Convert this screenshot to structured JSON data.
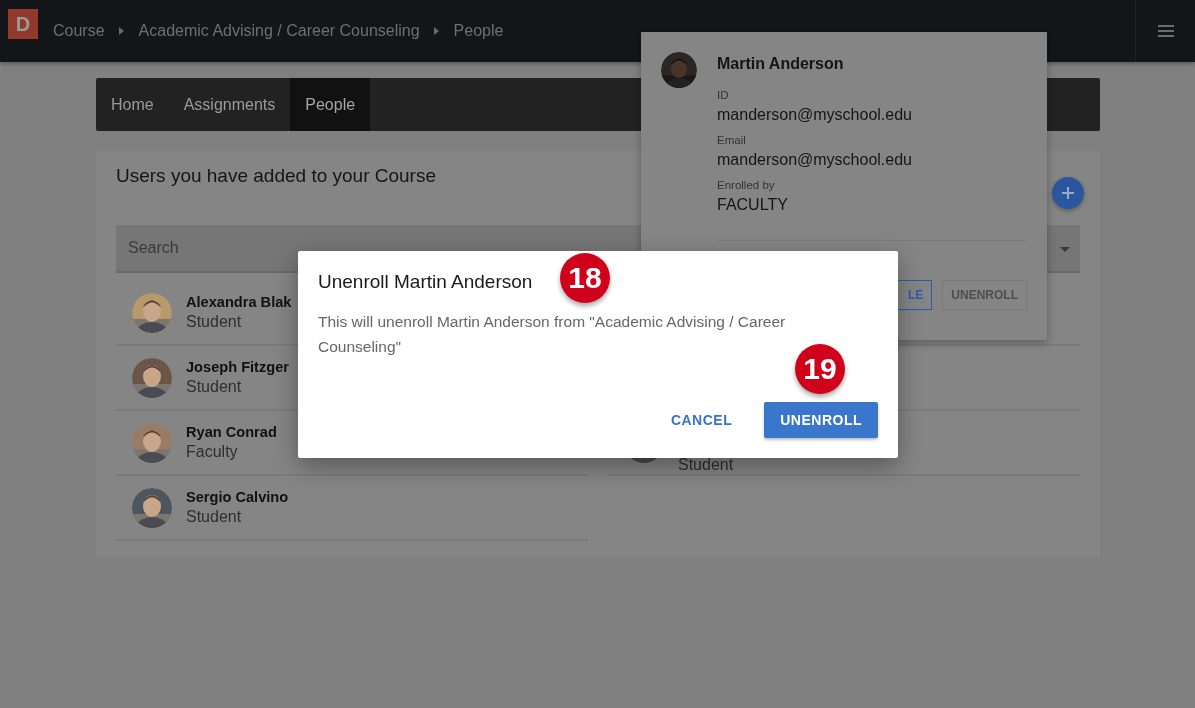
{
  "top_bar": {
    "logo": "D",
    "breadcrumbs": [
      "Course",
      "Academic Advising / Career Counseling",
      "People"
    ]
  },
  "tabs": [
    {
      "label": "Home",
      "selected": false
    },
    {
      "label": "Assignments",
      "selected": false
    },
    {
      "label": "People",
      "selected": true
    }
  ],
  "card": {
    "title": "Users you have added to your Course",
    "search": {
      "placeholder": "Search"
    },
    "people": [
      {
        "name": "Alexandra Blak",
        "role": "Student"
      },
      {
        "name": "Joseph Fitzger",
        "role": "Student"
      },
      {
        "name": "Ryan Conrad",
        "role": "Faculty"
      },
      {
        "name": "Sergio Calvino",
        "role": "Student"
      }
    ],
    "people_right": [
      {
        "role": "Student"
      }
    ]
  },
  "profile_popover": {
    "name": "Martin Anderson",
    "fields": [
      {
        "label": "ID",
        "value": "manderson@myschool.edu"
      },
      {
        "label": "Email",
        "value": "manderson@myschool.edu"
      },
      {
        "label": "Enrolled by",
        "value": "FACULTY"
      }
    ],
    "buttons": [
      {
        "label": "LE",
        "disabled": false
      },
      {
        "label": "UNENROLL",
        "disabled": true
      }
    ]
  },
  "dialog": {
    "title": "Unenroll Martin Anderson",
    "message": "This will unenroll Martin Anderson from \"Academic Advising / Career Counseling\"",
    "buttons": [
      {
        "label": "CANCEL",
        "kind": "text"
      },
      {
        "label": "UNENROLL",
        "kind": "filled"
      }
    ]
  },
  "callouts": [
    "18",
    "19"
  ]
}
